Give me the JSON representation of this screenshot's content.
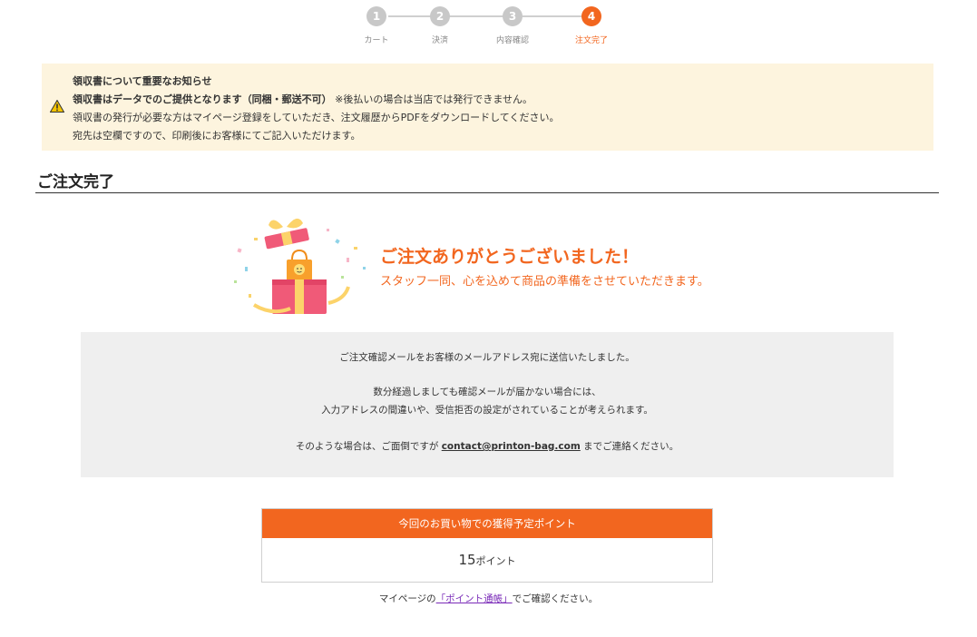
{
  "steps": [
    {
      "num": "1",
      "label": "カート"
    },
    {
      "num": "2",
      "label": "決済"
    },
    {
      "num": "3",
      "label": "内容確認"
    },
    {
      "num": "4",
      "label": "注文完了"
    }
  ],
  "notice": {
    "title": "領収書について重要なお知らせ",
    "line2_bold": "領収書はデータでのご提供となります（同梱・郵送不可）",
    "line2_rest": "※後払いの場合は当店では発行できません。",
    "line3": "領収書の発行が必要な方はマイページ登録をしていただき、注文履歴からPDFをダウンロードしてください。",
    "line4": "宛先は空欄ですので、印刷後にお客様にてご記入いただけます。"
  },
  "section_title": "ご注文完了",
  "thanks": {
    "title": "ご注文ありがとうございました！",
    "subtitle": "スタッフ一同、心を込めて商品の準備をさせていただきます。"
  },
  "info": {
    "line1": "ご注文確認メールをお客様のメールアドレス宛に送信いたしました。",
    "line2": "数分経過しましても確認メールが届かない場合には、",
    "line3": "入力アドレスの間違いや、受信拒否の設定がされていることが考えられます。",
    "line4_pre": "そのような場合は、ご面倒ですが",
    "email": "contact@printon-bag.com",
    "line4_post": "までご連絡ください。"
  },
  "points": {
    "header": "今回のお買い物での獲得予定ポイント",
    "value": "15",
    "unit": "ポイント"
  },
  "mypage_note": {
    "pre": "マイページの",
    "link": "「ポイント通帳」",
    "post": "でご確認ください。"
  },
  "colors": {
    "accent": "#f2661f",
    "notice_bg": "#fdf4de",
    "info_bg": "#efefef",
    "link": "#7a2bb8"
  }
}
